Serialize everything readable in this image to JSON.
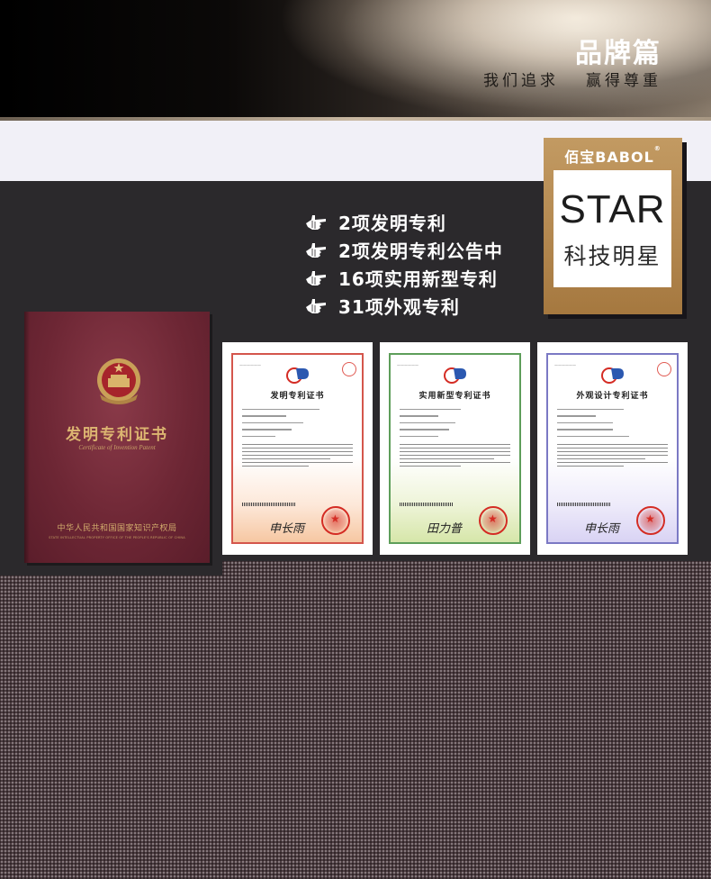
{
  "banner": {
    "title": "品牌篇",
    "slogan_left": "我们追求",
    "slogan_right": "赢得尊重"
  },
  "badge": {
    "brand": "佰宝BABOL",
    "registered": "®",
    "star": "STAR",
    "subtitle": "科技明星"
  },
  "patents": [
    {
      "label": "2项发明专利",
      "icon": "pointing-hand-icon"
    },
    {
      "label": "2项发明专利公告中",
      "icon": "pointing-hand-icon"
    },
    {
      "label": "16项实用新型专利",
      "icon": "pointing-hand-icon"
    },
    {
      "label": "31项外观专利",
      "icon": "pointing-hand-icon"
    }
  ],
  "book": {
    "title": "发明专利证书",
    "subtitle": "Certificate of Invention Patent",
    "issuer": "中华人民共和国国家知识产权局",
    "issuer_en": "STATE INTELLECTUAL PROPERTY OFFICE OF THE PEOPLE'S REPUBLIC OF CHINA"
  },
  "certificates": [
    {
      "title": "发明专利证书",
      "accent": "#d4564c",
      "signature": "申长雨"
    },
    {
      "title": "实用新型专利证书",
      "accent": "#5e9e5a",
      "signature": "田力普"
    },
    {
      "title": "外观设计专利证书",
      "accent": "#7b79c4",
      "signature": "申长雨"
    }
  ],
  "colors": {
    "dark_panel": "#2b292c",
    "badge_gold": "#b58a52",
    "book_red": "#6e2735",
    "book_gold": "#dcb571"
  }
}
